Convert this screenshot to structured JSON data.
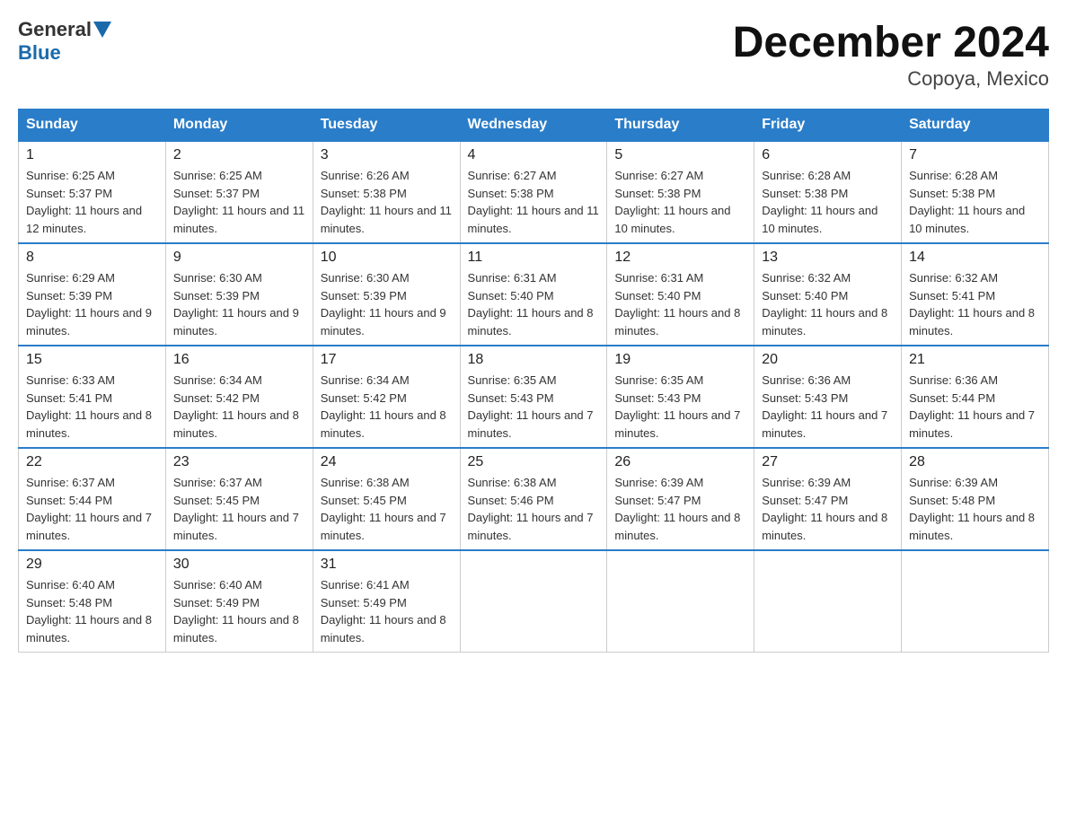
{
  "header": {
    "logo_general": "General",
    "logo_blue": "Blue",
    "month_title": "December 2024",
    "location": "Copoya, Mexico"
  },
  "columns": [
    "Sunday",
    "Monday",
    "Tuesday",
    "Wednesday",
    "Thursday",
    "Friday",
    "Saturday"
  ],
  "weeks": [
    [
      {
        "day": "1",
        "sunrise": "6:25 AM",
        "sunset": "5:37 PM",
        "daylight": "11 hours and 12 minutes."
      },
      {
        "day": "2",
        "sunrise": "6:25 AM",
        "sunset": "5:37 PM",
        "daylight": "11 hours and 11 minutes."
      },
      {
        "day": "3",
        "sunrise": "6:26 AM",
        "sunset": "5:38 PM",
        "daylight": "11 hours and 11 minutes."
      },
      {
        "day": "4",
        "sunrise": "6:27 AM",
        "sunset": "5:38 PM",
        "daylight": "11 hours and 11 minutes."
      },
      {
        "day": "5",
        "sunrise": "6:27 AM",
        "sunset": "5:38 PM",
        "daylight": "11 hours and 10 minutes."
      },
      {
        "day": "6",
        "sunrise": "6:28 AM",
        "sunset": "5:38 PM",
        "daylight": "11 hours and 10 minutes."
      },
      {
        "day": "7",
        "sunrise": "6:28 AM",
        "sunset": "5:38 PM",
        "daylight": "11 hours and 10 minutes."
      }
    ],
    [
      {
        "day": "8",
        "sunrise": "6:29 AM",
        "sunset": "5:39 PM",
        "daylight": "11 hours and 9 minutes."
      },
      {
        "day": "9",
        "sunrise": "6:30 AM",
        "sunset": "5:39 PM",
        "daylight": "11 hours and 9 minutes."
      },
      {
        "day": "10",
        "sunrise": "6:30 AM",
        "sunset": "5:39 PM",
        "daylight": "11 hours and 9 minutes."
      },
      {
        "day": "11",
        "sunrise": "6:31 AM",
        "sunset": "5:40 PM",
        "daylight": "11 hours and 8 minutes."
      },
      {
        "day": "12",
        "sunrise": "6:31 AM",
        "sunset": "5:40 PM",
        "daylight": "11 hours and 8 minutes."
      },
      {
        "day": "13",
        "sunrise": "6:32 AM",
        "sunset": "5:40 PM",
        "daylight": "11 hours and 8 minutes."
      },
      {
        "day": "14",
        "sunrise": "6:32 AM",
        "sunset": "5:41 PM",
        "daylight": "11 hours and 8 minutes."
      }
    ],
    [
      {
        "day": "15",
        "sunrise": "6:33 AM",
        "sunset": "5:41 PM",
        "daylight": "11 hours and 8 minutes."
      },
      {
        "day": "16",
        "sunrise": "6:34 AM",
        "sunset": "5:42 PM",
        "daylight": "11 hours and 8 minutes."
      },
      {
        "day": "17",
        "sunrise": "6:34 AM",
        "sunset": "5:42 PM",
        "daylight": "11 hours and 8 minutes."
      },
      {
        "day": "18",
        "sunrise": "6:35 AM",
        "sunset": "5:43 PM",
        "daylight": "11 hours and 7 minutes."
      },
      {
        "day": "19",
        "sunrise": "6:35 AM",
        "sunset": "5:43 PM",
        "daylight": "11 hours and 7 minutes."
      },
      {
        "day": "20",
        "sunrise": "6:36 AM",
        "sunset": "5:43 PM",
        "daylight": "11 hours and 7 minutes."
      },
      {
        "day": "21",
        "sunrise": "6:36 AM",
        "sunset": "5:44 PM",
        "daylight": "11 hours and 7 minutes."
      }
    ],
    [
      {
        "day": "22",
        "sunrise": "6:37 AM",
        "sunset": "5:44 PM",
        "daylight": "11 hours and 7 minutes."
      },
      {
        "day": "23",
        "sunrise": "6:37 AM",
        "sunset": "5:45 PM",
        "daylight": "11 hours and 7 minutes."
      },
      {
        "day": "24",
        "sunrise": "6:38 AM",
        "sunset": "5:45 PM",
        "daylight": "11 hours and 7 minutes."
      },
      {
        "day": "25",
        "sunrise": "6:38 AM",
        "sunset": "5:46 PM",
        "daylight": "11 hours and 7 minutes."
      },
      {
        "day": "26",
        "sunrise": "6:39 AM",
        "sunset": "5:47 PM",
        "daylight": "11 hours and 8 minutes."
      },
      {
        "day": "27",
        "sunrise": "6:39 AM",
        "sunset": "5:47 PM",
        "daylight": "11 hours and 8 minutes."
      },
      {
        "day": "28",
        "sunrise": "6:39 AM",
        "sunset": "5:48 PM",
        "daylight": "11 hours and 8 minutes."
      }
    ],
    [
      {
        "day": "29",
        "sunrise": "6:40 AM",
        "sunset": "5:48 PM",
        "daylight": "11 hours and 8 minutes."
      },
      {
        "day": "30",
        "sunrise": "6:40 AM",
        "sunset": "5:49 PM",
        "daylight": "11 hours and 8 minutes."
      },
      {
        "day": "31",
        "sunrise": "6:41 AM",
        "sunset": "5:49 PM",
        "daylight": "11 hours and 8 minutes."
      },
      null,
      null,
      null,
      null
    ]
  ]
}
